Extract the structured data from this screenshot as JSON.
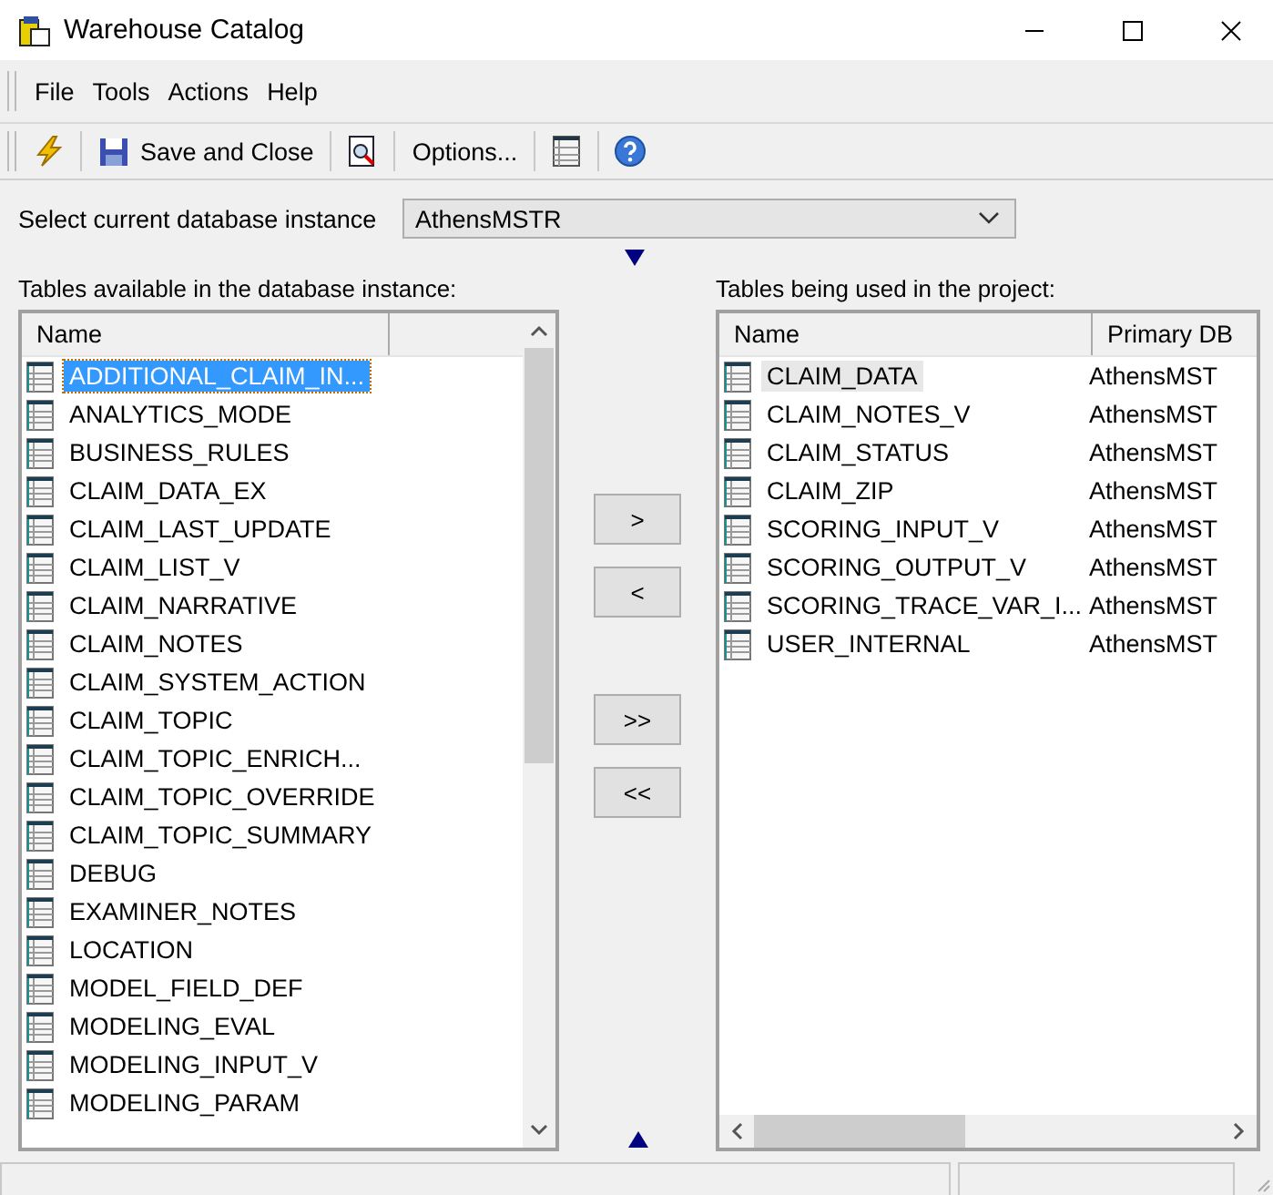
{
  "window": {
    "title": "Warehouse Catalog"
  },
  "menu": [
    "File",
    "Tools",
    "Actions",
    "Help"
  ],
  "toolbar": [
    {
      "kind": "icon"
    },
    {
      "kind": "button",
      "label": "Save and Close"
    },
    {
      "kind": "icon"
    },
    {
      "kind": "button",
      "label": "Options..."
    },
    {
      "kind": "icon"
    },
    {
      "kind": "icon"
    }
  ],
  "instance": {
    "label": "Select current database instance",
    "value": "AthensMSTR"
  },
  "available": {
    "label": "Tables available in the database instance:",
    "columns": [
      "Name"
    ],
    "rows": [
      {
        "name": "ADDITIONAL_CLAIM_IN...",
        "selected": true
      },
      {
        "name": "ANALYTICS_MODE",
        "selected": false
      },
      {
        "name": "BUSINESS_RULES",
        "selected": false
      },
      {
        "name": "CLAIM_DATA_EX",
        "selected": false
      },
      {
        "name": "CLAIM_LAST_UPDATE",
        "selected": false
      },
      {
        "name": "CLAIM_LIST_V",
        "selected": false
      },
      {
        "name": "CLAIM_NARRATIVE",
        "selected": false
      },
      {
        "name": "CLAIM_NOTES",
        "selected": false
      },
      {
        "name": "CLAIM_SYSTEM_ACTION",
        "selected": false
      },
      {
        "name": "CLAIM_TOPIC",
        "selected": false
      },
      {
        "name": "CLAIM_TOPIC_ENRICH...",
        "selected": false
      },
      {
        "name": "CLAIM_TOPIC_OVERRIDE",
        "selected": false
      },
      {
        "name": "CLAIM_TOPIC_SUMMARY",
        "selected": false
      },
      {
        "name": "DEBUG",
        "selected": false
      },
      {
        "name": "EXAMINER_NOTES",
        "selected": false
      },
      {
        "name": "LOCATION",
        "selected": false
      },
      {
        "name": "MODEL_FIELD_DEF",
        "selected": false
      },
      {
        "name": "MODELING_EVAL",
        "selected": false
      },
      {
        "name": "MODELING_INPUT_V",
        "selected": false
      },
      {
        "name": "MODELING_PARAM",
        "selected": false
      }
    ]
  },
  "transfer_buttons": [
    ">",
    "<",
    ">>",
    "<<"
  ],
  "used": {
    "label": "Tables being used in the project:",
    "columns": [
      "Name",
      "Primary DB"
    ],
    "rows": [
      {
        "name": "CLAIM_DATA",
        "db": "AthensMST",
        "selected": true
      },
      {
        "name": "CLAIM_NOTES_V",
        "db": "AthensMST",
        "selected": false
      },
      {
        "name": "CLAIM_STATUS",
        "db": "AthensMST",
        "selected": false
      },
      {
        "name": "CLAIM_ZIP",
        "db": "AthensMST",
        "selected": false
      },
      {
        "name": "SCORING_INPUT_V",
        "db": "AthensMST",
        "selected": false
      },
      {
        "name": "SCORING_OUTPUT_V",
        "db": "AthensMST",
        "selected": false
      },
      {
        "name": "SCORING_TRACE_VAR_I...",
        "db": "AthensMST",
        "selected": false
      },
      {
        "name": "USER_INTERNAL",
        "db": "AthensMST",
        "selected": false
      }
    ]
  }
}
